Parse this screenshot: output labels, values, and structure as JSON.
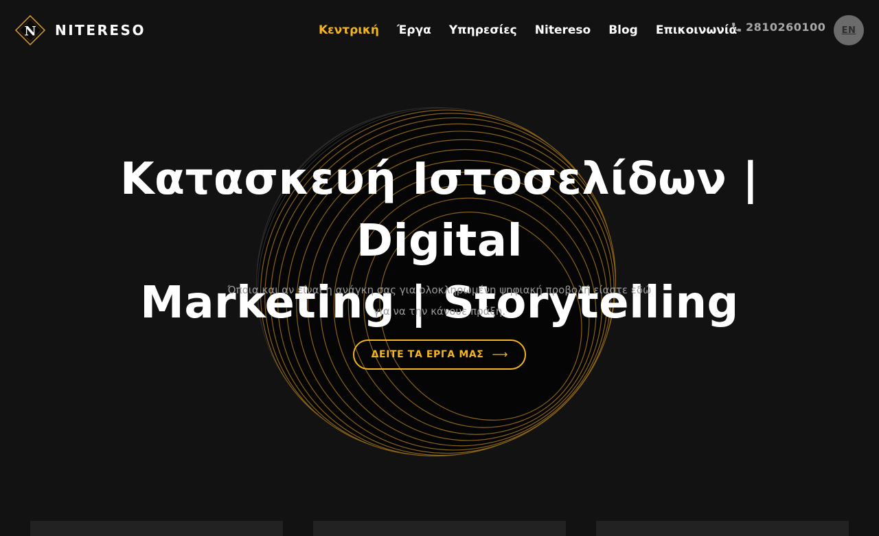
{
  "brand": {
    "name": "NITERESO",
    "mark_letter": "N",
    "accent_color": "#f5b51e",
    "background_color": "#121212"
  },
  "nav": {
    "items": [
      {
        "label": "Κεντρική",
        "active": true
      },
      {
        "label": "Έργα",
        "active": false
      },
      {
        "label": "Υπηρεσίες",
        "active": false
      },
      {
        "label": "Nitereso",
        "active": false
      },
      {
        "label": "Blog",
        "active": false
      },
      {
        "label": "Επικοινωνία",
        "active": false
      }
    ],
    "phone": "2810260100",
    "phone_icon": "phone-icon",
    "language": "EN"
  },
  "hero": {
    "title_line1": "Κατασκευή Ιστοσελίδων | Digital",
    "title_line2": "Marketing | Storytelling",
    "subtitle": "Όποια και αν είναι η ανάγκη σας για ολοκληρωμένη ψηφιακή προβολή είαστε εδώ για να την κάνουε πράξη.",
    "cta_label": "ΔΕΙΤΕ ΤΑ ΕΡΓΑ ΜΑΣ",
    "cta_arrow": "⟶",
    "decoration": "ribbed-sphere-graphic"
  }
}
